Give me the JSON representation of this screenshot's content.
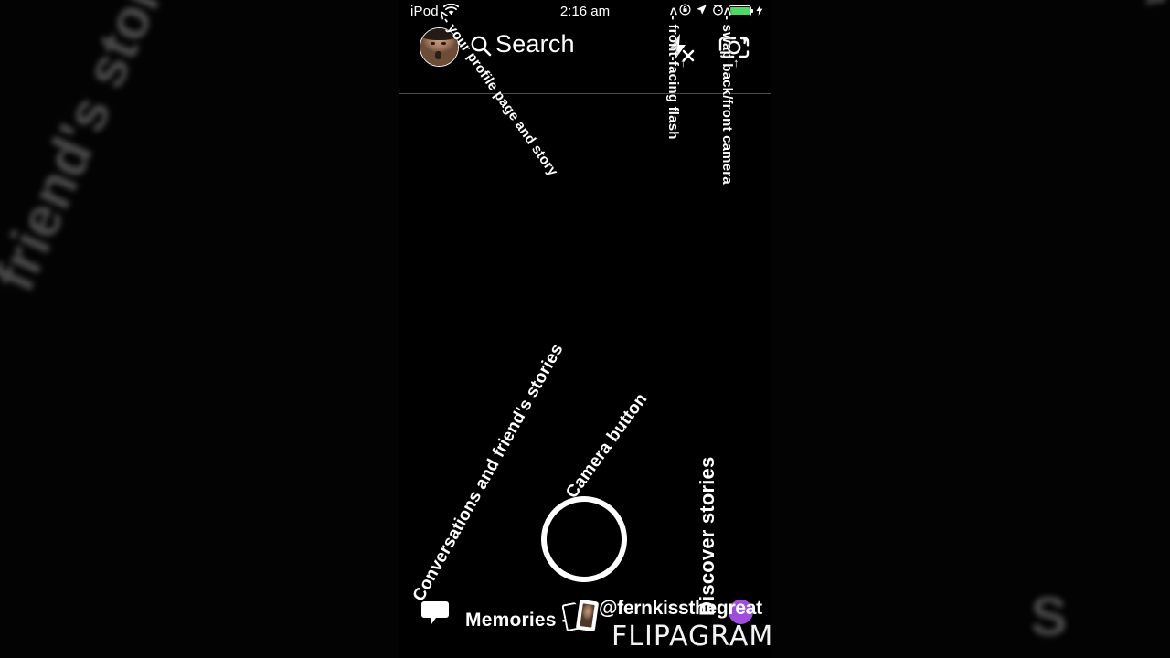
{
  "background": {
    "left_text": "friend's stories",
    "right_top_text": "mera",
    "right_bottom_text": "S"
  },
  "status_bar": {
    "carrier": "iPod",
    "wifi_icon": "wifi-icon",
    "time": "2:16 am",
    "rotation_lock_icon": "rotation-lock-icon",
    "location_icon": "location-arrow-icon",
    "alarm_icon": "alarm-clock-icon",
    "battery_icon": "battery-icon",
    "battery_color": "#4cd964",
    "charging_icon": "lightning-bolt-icon"
  },
  "header": {
    "avatar_name": "profile-avatar",
    "search_icon": "search-icon",
    "search_label": "Search",
    "flash_icon": "flash-off-icon",
    "camera_flip_icon": "camera-flip-icon"
  },
  "annotations": {
    "profile": "<- your profile page and story",
    "flash": "<- front-facing flash",
    "swap": "<- swap back/front camera",
    "conversations": "Conversations and friend's stories",
    "camera_button": "Camera button",
    "discover": "Discover stories",
    "tick_flash": "↑",
    "tick_swap": "↑"
  },
  "camera": {
    "shutter_name": "camera-shutter-button"
  },
  "bottom_bar": {
    "chat_icon": "chat-bubble-icon",
    "memories_label": "Memories ->",
    "memories_icon": "memories-cards-icon",
    "discover_dot_color": "#9d4edd",
    "username": "@fernkissthegreat",
    "watermark": "FLIPAGRAM"
  }
}
